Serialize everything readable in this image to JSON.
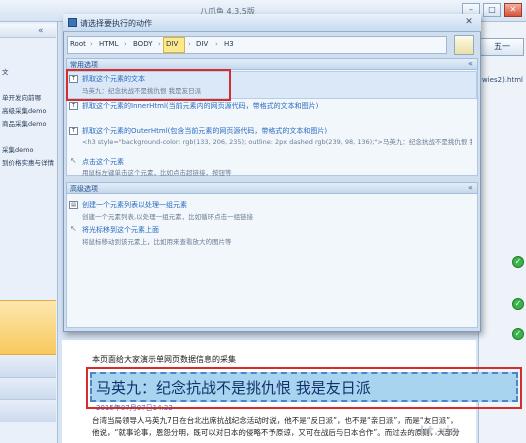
{
  "app": {
    "title": "八爪鱼 4.3.5版",
    "next_label": "五一",
    "url_fragment": "wies2).html"
  },
  "left_tree": {
    "items": [
      "文",
      "",
      "单开发向前哪",
      "高级采集demo",
      "商品采集demo",
      "",
      "采集demo",
      "到价格实惠与详情"
    ]
  },
  "dialog": {
    "title": "请选择要执行的动作",
    "close": "✕",
    "path": [
      "Root",
      "HTML",
      "BODY",
      "DIV",
      "DIV",
      "H3"
    ],
    "sections": {
      "common": {
        "title": "常用选项",
        "options": [
          {
            "title": "抓取这个元素的文本",
            "desc": "马英九：纪念抗战不是挑仇恨 我是友日派"
          },
          {
            "title": "抓取这个元素的InnerHtml(当前元素内的网页源代码，带格式的文本和图片)",
            "desc": ""
          },
          {
            "title": "抓取这个元素的OuterHtml(包含当前元素的网页源代码，带格式的文本和图片)",
            "desc": "<h3 style=\"background-color: rgb(133, 206, 235); outline: 2px dashed rgb(239, 98, 136);\">马英九：纪念抗战不是挑仇恨 我是友日派</h3>"
          },
          {
            "title": "点击这个元素",
            "desc": "用鼠标左键单击这个元素，比如点击超链接，按钮等"
          }
        ]
      },
      "advanced": {
        "title": "高级选项",
        "options": [
          {
            "title": "创建一个元素列表以处理一组元素",
            "desc": "创建一个元素列表,以处理一组元素，比如循环点击一组链接"
          },
          {
            "title": "将光标移到这个元素上面",
            "desc": "将鼠标移动到该元素上，比如用来查看放大的图片等"
          }
        ]
      }
    }
  },
  "article": {
    "intro": "本页面给大家演示单网页数据信息的采集",
    "title": "马英九：纪念抗战不是挑仇恨 我是友日派",
    "date": "2015年07月07日14:32",
    "body_line1": "台湾当局领导人马英九7日在台北出席抗战纪念活动时说，他不是“反日派”，也不是“亲日派”，而是“友日派”，",
    "body_line2": "他说，“就事论事，恩怨分明，既可以对日本的侵略不予原谅，又可在战后与日本合作”。而过去的原则，大部分"
  },
  "watermark": "kt.xia"
}
